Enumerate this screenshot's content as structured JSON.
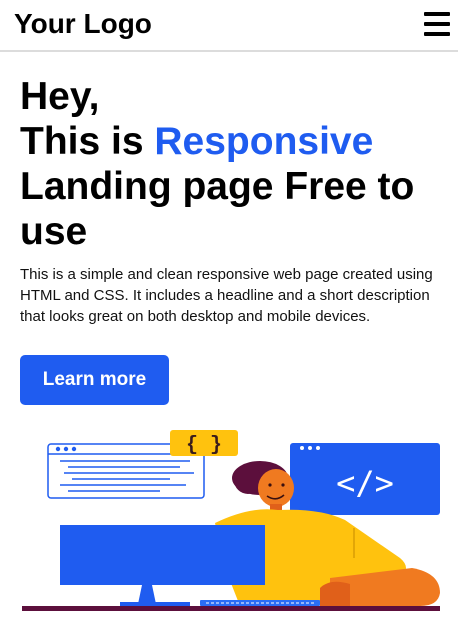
{
  "header": {
    "logo": "Your Logo",
    "menu_icon": "hamburger-menu-icon"
  },
  "hero": {
    "headline_line1": "Hey,",
    "headline_line2_prefix": "This is ",
    "headline_accent": "Responsive",
    "headline_line3": "Landing page Free to use",
    "description_lines": [
      "This is a simple and clean responsive web page created using",
      "HTML and CSS. It includes a headline and a short description",
      "that looks great on both desktop and mobile devices."
    ],
    "cta_label": "Learn more"
  },
  "illustration": {
    "braces_text": "{ }",
    "code_tag_text": "</>",
    "icon": "developer-at-computer-illustration"
  },
  "colors": {
    "accent": "#1f5cf0",
    "text": "#000000",
    "yellow": "#ffc20e",
    "orange": "#f07a20",
    "plum": "#5c0f3c"
  }
}
